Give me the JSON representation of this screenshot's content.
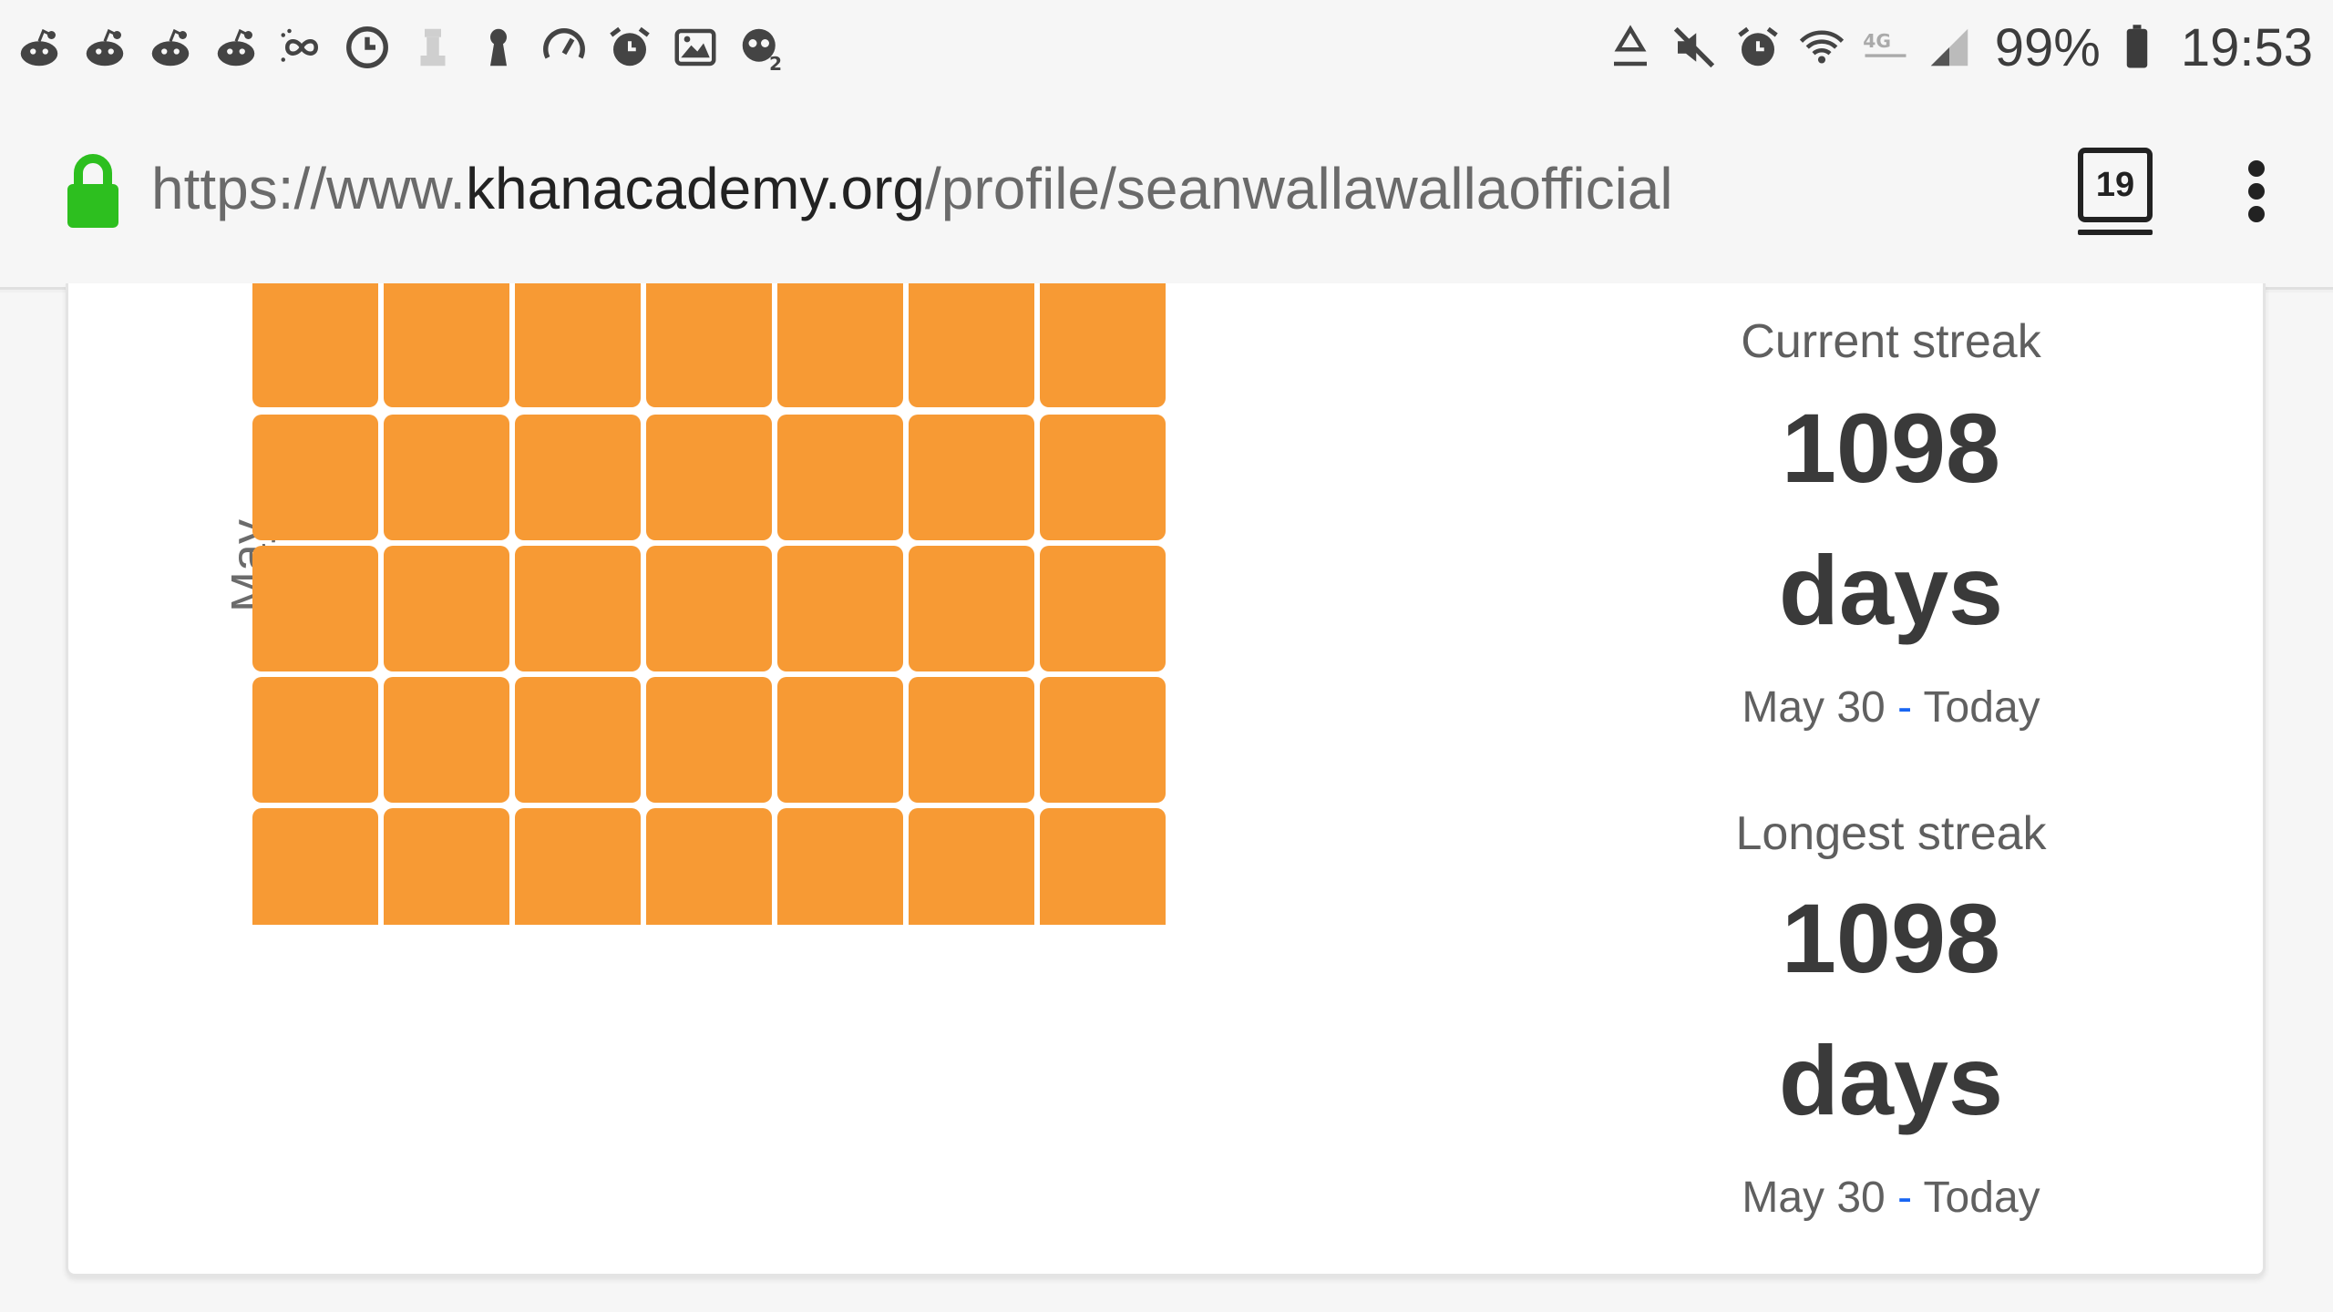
{
  "status_bar": {
    "left_icons": [
      "reddit-icon",
      "reddit-icon",
      "reddit-icon",
      "reddit-icon",
      "infinity-sync-icon",
      "clock-icon",
      "chess-icon",
      "keyhole-icon",
      "speedometer-icon",
      "alarm-icon",
      "image-icon",
      "game-controller-icon"
    ],
    "right_icons": [
      "recycle-icon",
      "mute-icon",
      "alarm-icon",
      "wifi-icon",
      "4g-lte-icon",
      "signal-icon"
    ],
    "battery_percent": "99%",
    "time": "19:53"
  },
  "browser": {
    "url_prefix": "https://www.",
    "url_domain": "khanacademy.org",
    "url_path": "/profile/seanwallawallaofficial",
    "tab_count": "19",
    "lock_color": "#2dbf1f"
  },
  "calendar": {
    "month": "May",
    "cell_color": "#f79a34",
    "rows": 5,
    "columns": 7
  },
  "streaks": {
    "current": {
      "heading": "Current streak",
      "value": "1098",
      "unit": "days",
      "start": "May 30",
      "dash": "-",
      "end": "Today"
    },
    "longest": {
      "heading": "Longest streak",
      "value": "1098",
      "unit": "days",
      "start": "May 30",
      "dash": "-",
      "end": "Today"
    }
  }
}
